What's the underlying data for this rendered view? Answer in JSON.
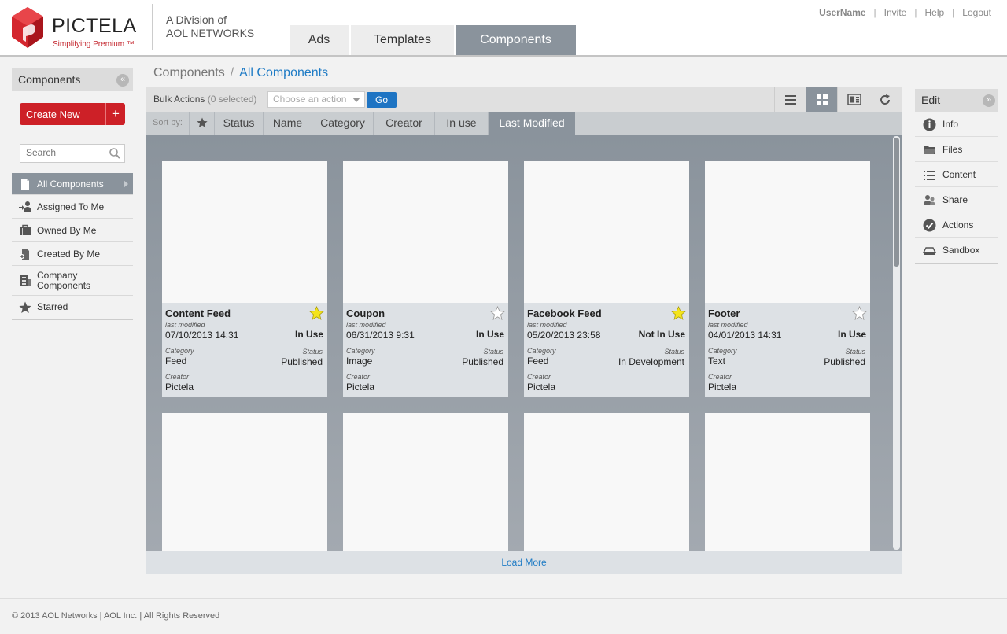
{
  "brand": {
    "name": "PICTELA",
    "tagline": "Simplifying Premium ™",
    "division_line1": "A Division of",
    "division_line2": "AOL NETWORKS",
    "accent_color": "#cd2027"
  },
  "top_tabs": [
    {
      "label": "Ads",
      "active": false
    },
    {
      "label": "Templates",
      "active": false
    },
    {
      "label": "Components",
      "active": true
    }
  ],
  "user_links": {
    "username": "UserName",
    "invite": "Invite",
    "help": "Help",
    "logout": "Logout"
  },
  "left_panel": {
    "title": "Components",
    "collapse_icon": "double-chevron-left-icon",
    "create_new": "Create New",
    "create_plus": "+",
    "search_placeholder": "Search",
    "nav": [
      {
        "label": "All Components",
        "icon": "document-icon",
        "active": true
      },
      {
        "label": "Assigned To Me",
        "icon": "assign-user-icon"
      },
      {
        "label": "Owned By Me",
        "icon": "briefcase-icon"
      },
      {
        "label": "Created By Me",
        "icon": "create-document-icon"
      },
      {
        "label_line1": "Company",
        "label_line2": "Components",
        "icon": "building-icon"
      },
      {
        "label": "Starred",
        "icon": "star-icon"
      }
    ]
  },
  "breadcrumb": {
    "root": "Components",
    "separator": "/",
    "current": "All Components"
  },
  "toolbar": {
    "bulk_label": "Bulk Actions",
    "selected_count": "(0 selected)",
    "action_placeholder": "Choose an action",
    "go": "Go",
    "view_icons": [
      "list-view-icon",
      "grid-view-icon",
      "detail-view-icon",
      "refresh-icon"
    ],
    "active_view": "grid-view-icon"
  },
  "sort": {
    "label": "Sort by:",
    "star_icon": "star-icon",
    "options": [
      "Status",
      "Name",
      "Category",
      "Creator",
      "In use",
      "Last Modified"
    ],
    "active": "Last Modified"
  },
  "card_labels": {
    "last_modified": "last modified",
    "category": "Category",
    "status": "Status",
    "creator": "Creator"
  },
  "cards": [
    {
      "title": "Content Feed",
      "starred": true,
      "modified": "07/10/2013 14:31",
      "usage": "In Use",
      "category": "Feed",
      "status": "Published",
      "creator": "Pictela"
    },
    {
      "title": "Coupon",
      "starred": false,
      "modified": "06/31/2013  9:31",
      "usage": "In Use",
      "category": "Image",
      "status": "Published",
      "creator": "Pictela"
    },
    {
      "title": "Facebook Feed",
      "starred": true,
      "modified": "05/20/2013  23:58",
      "usage": "Not In Use",
      "category": "Feed",
      "status": "In Development",
      "creator": "Pictela"
    },
    {
      "title": "Footer",
      "starred": false,
      "modified": "04/01/2013  14:31",
      "usage": "In Use",
      "category": "Text",
      "status": "Published",
      "creator": "Pictela"
    }
  ],
  "load_more": "Load More",
  "right_panel": {
    "title": "Edit",
    "collapse_icon": "double-chevron-right-icon",
    "items": [
      {
        "label": "Info",
        "icon": "info-icon"
      },
      {
        "label": "Files",
        "icon": "folder-icon"
      },
      {
        "label": "Content",
        "icon": "list-icon"
      },
      {
        "label": "Share",
        "icon": "share-users-icon"
      },
      {
        "label": "Actions",
        "icon": "check-circle-icon"
      },
      {
        "label": "Sandbox",
        "icon": "sandbox-icon"
      }
    ]
  },
  "footer": "© 2013 AOL Networks | AOL Inc. | All Rights Reserved"
}
